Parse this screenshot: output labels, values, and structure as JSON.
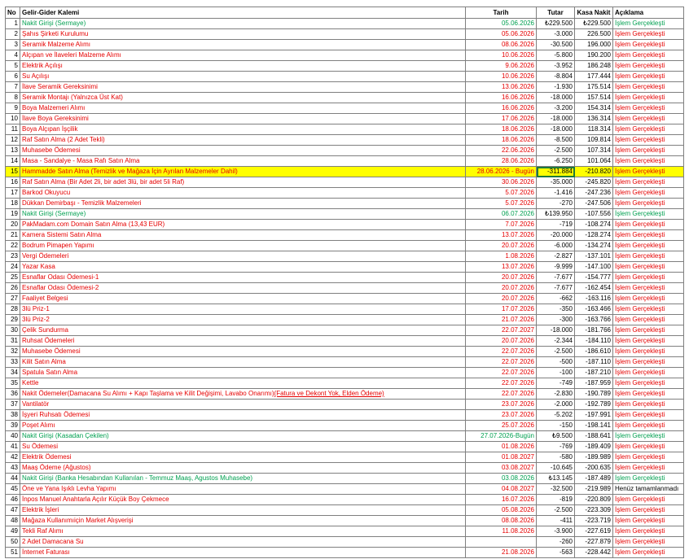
{
  "headers": {
    "no": "No",
    "item": "Gelir-Gider Kalemi",
    "date": "Tarih",
    "amount": "Tutar",
    "cash": "Kasa Nakit",
    "note": "Açıklama"
  },
  "colors": {
    "expense": "#e60000",
    "income": "#00a050",
    "highlight": "#ffff00"
  },
  "rows": [
    {
      "no": "1",
      "item": "Nakit Girişi (Sermaye)",
      "date": "05.06.2026",
      "amount": "₺229.500",
      "cash": "₺229.500",
      "note": "İşlem Gerçekleşti",
      "type": "green"
    },
    {
      "no": "2",
      "item": "Şahıs Şirketi Kurulumu",
      "date": "05.06.2026",
      "amount": "-3.000",
      "cash": "226.500",
      "note": "İşlem Gerçekleşti",
      "type": "red"
    },
    {
      "no": "3",
      "item": "Seramik Malzeme Alımı",
      "date": "08.06.2026",
      "amount": "-30.500",
      "cash": "196.000",
      "note": "İşlem Gerçekleşti",
      "type": "red"
    },
    {
      "no": "4",
      "item": "Alçıpan ve İlaveleri Malzeme Alımı",
      "date": "10.06.2026",
      "amount": "-5.800",
      "cash": "190.200",
      "note": "İşlem Gerçekleşti",
      "type": "red"
    },
    {
      "no": "5",
      "item": "Elektrik Açılışı",
      "date": "9.06.2026",
      "amount": "-3.952",
      "cash": "186.248",
      "note": "İşlem Gerçekleşti",
      "type": "red"
    },
    {
      "no": "6",
      "item": "Su Açılışı",
      "date": "10.06.2026",
      "amount": "-8.804",
      "cash": "177.444",
      "note": "İşlem Gerçekleşti",
      "type": "red"
    },
    {
      "no": "7",
      "item": "İlave Seramik Gereksinimi",
      "date": "13.06.2026",
      "amount": "-1.930",
      "cash": "175.514",
      "note": "İşlem Gerçekleşti",
      "type": "red"
    },
    {
      "no": "8",
      "item": "Seramik Montajı (Yalnızca Üst Kat)",
      "date": "16.06.2026",
      "amount": "-18.000",
      "cash": "157.514",
      "note": "İşlem Gerçekleşti",
      "type": "red"
    },
    {
      "no": "9",
      "item": "Boya Malzemeri Alımı",
      "date": "16.06.2026",
      "amount": "-3.200",
      "cash": "154.314",
      "note": "İşlem Gerçekleşti",
      "type": "red"
    },
    {
      "no": "10",
      "item": "İlave Boya Gereksinimi",
      "date": "17.06.2026",
      "amount": "-18.000",
      "cash": "136.314",
      "note": "İşlem Gerçekleşti",
      "type": "red"
    },
    {
      "no": "11",
      "item": "Boya Alçıpan İşçilik",
      "date": "18.06.2026",
      "amount": "-18.000",
      "cash": "118.314",
      "note": "İşlem Gerçekleşti",
      "type": "red"
    },
    {
      "no": "12",
      "item": "Raf Satın Alma (2 Adet Tekli)",
      "date": "18.06.2026",
      "amount": "-8.500",
      "cash": "109.814",
      "note": "İşlem Gerçekleşti",
      "type": "red"
    },
    {
      "no": "13",
      "item": "Muhasebe Ödemesi",
      "date": "22.06.2026",
      "amount": "-2.500",
      "cash": "107.314",
      "note": "İşlem Gerçekleşti",
      "type": "red"
    },
    {
      "no": "14",
      "item": "Masa - Sandalye - Masa Rafı Satın Alma",
      "date": "28.06.2026",
      "amount": "-6.250",
      "cash": "101.064",
      "note": "İşlem Gerçekleşti",
      "type": "red"
    },
    {
      "no": "15",
      "item": "Hammadde Satın Alma (Temizlik ve Mağaza İçin Ayrılan Malzemeler Dahil)",
      "date": "28.06.2026 - Bugün",
      "amount": "-311.884",
      "cash": "-210.820",
      "note": "İşlem Gerçekleşti",
      "type": "red",
      "highlight": true
    },
    {
      "no": "16",
      "item": "Raf Satın Alma (Bir Adet 2li, bir adet 3lü, bir adet 5li Raf)",
      "date": "30.06.2026",
      "amount": "-35.000",
      "cash": "-245.820",
      "note": "İşlem Gerçekleşti",
      "type": "red"
    },
    {
      "no": "17",
      "item": "Barkod Okuyucu",
      "date": "5.07.2026",
      "amount": "-1.416",
      "cash": "-247.236",
      "note": "İşlem Gerçekleşti",
      "type": "red"
    },
    {
      "no": "18",
      "item": "Dükkan Demirbaşı - Temizlik Malzemeleri",
      "date": "5.07.2026",
      "amount": "-270",
      "cash": "-247.506",
      "note": "İşlem Gerçekleşti",
      "type": "red"
    },
    {
      "no": "19",
      "item": "Nakit Girişi (Sermaye)",
      "date": "06.07.2026",
      "amount": "₺139.950",
      "cash": "-107.556",
      "note": "İşlem Gerçekleşti",
      "type": "green"
    },
    {
      "no": "20",
      "item": "PakMadam.com Domain Satın Alma (13,43 EUR)",
      "date": "7.07.2026",
      "amount": "-719",
      "cash": "-108.274",
      "note": "İşlem Gerçekleşti",
      "type": "red"
    },
    {
      "no": "21",
      "item": "Kamera Sistemi Satın Alma",
      "date": "13.07.2026",
      "amount": "-20.000",
      "cash": "-128.274",
      "note": "İşlem Gerçekleşti",
      "type": "red"
    },
    {
      "no": "22",
      "item": "Bodrum Pimapen Yapımı",
      "date": "20.07.2026",
      "amount": "-6.000",
      "cash": "-134.274",
      "note": "İşlem Gerçekleşti",
      "type": "red"
    },
    {
      "no": "23",
      "item": "Vergi Ödemeleri",
      "date": "1.08.2026",
      "amount": "-2.827",
      "cash": "-137.101",
      "note": "İşlem Gerçekleşti",
      "type": "red"
    },
    {
      "no": "24",
      "item": "Yazar Kasa",
      "date": "13.07.2026",
      "amount": "-9.999",
      "cash": "-147.100",
      "note": "İşlem Gerçekleşti",
      "type": "red"
    },
    {
      "no": "25",
      "item": "Esnaflar Odası Ödemesi-1",
      "date": "20.07.2026",
      "amount": "-7.677",
      "cash": "-154.777",
      "note": "İşlem Gerçekleşti",
      "type": "red"
    },
    {
      "no": "26",
      "item": "Esnaflar Odası Ödemesi-2",
      "date": "20.07.2026",
      "amount": "-7.677",
      "cash": "-162.454",
      "note": "İşlem Gerçekleşti",
      "type": "red"
    },
    {
      "no": "27",
      "item": "Faaliyet Belgesi",
      "date": "20.07.2026",
      "amount": "-662",
      "cash": "-163.116",
      "note": "İşlem Gerçekleşti",
      "type": "red"
    },
    {
      "no": "28",
      "item": "3lü Priz-1",
      "date": "17.07.2026",
      "amount": "-350",
      "cash": "-163.466",
      "note": "İşlem Gerçekleşti",
      "type": "red"
    },
    {
      "no": "29",
      "item": "3lü Priz-2",
      "date": "21.07.2026",
      "amount": "-300",
      "cash": "-163.766",
      "note": "İşlem Gerçekleşti",
      "type": "red"
    },
    {
      "no": "30",
      "item": "Çelik Sundurma",
      "date": "22.07.2027",
      "amount": "-18.000",
      "cash": "-181.766",
      "note": "İşlem Gerçekleşti",
      "type": "red"
    },
    {
      "no": "31",
      "item": "Ruhsat Ödemeleri",
      "date": "20.07.2026",
      "amount": "-2.344",
      "cash": "-184.110",
      "note": "İşlem Gerçekleşti",
      "type": "red"
    },
    {
      "no": "32",
      "item": "Muhasebe Ödemesi",
      "date": "22.07.2026",
      "amount": "-2.500",
      "cash": "-186.610",
      "note": "İşlem Gerçekleşti",
      "type": "red"
    },
    {
      "no": "33",
      "item": "Kilit Satın Alma",
      "date": "22.07.2026",
      "amount": "-500",
      "cash": "-187.110",
      "note": "İşlem Gerçekleşti",
      "type": "red"
    },
    {
      "no": "34",
      "item": "Spatula Satın Alma",
      "date": "22.07.2026",
      "amount": "-100",
      "cash": "-187.210",
      "note": "İşlem Gerçekleşti",
      "type": "red"
    },
    {
      "no": "35",
      "item": "Kettle",
      "date": "22.07.2026",
      "amount": "-749",
      "cash": "-187.959",
      "note": "İşlem Gerçekleşti",
      "type": "red"
    },
    {
      "no": "36",
      "item": "Nakit Ödemeler(Damacana Su Alımı + Kapı Taşlama ve Kilit Değişimi, Lavabo Onarımı)",
      "item_extra": "(Fatura ve Dekont Yok, Elden Ödeme)",
      "date": "22.07.2026",
      "amount": "-2.830",
      "cash": "-190.789",
      "note": "İşlem Gerçekleşti",
      "type": "red"
    },
    {
      "no": "37",
      "item": "Vantilatör",
      "date": "23.07.2026",
      "amount": "-2.000",
      "cash": "-192.789",
      "note": "İşlem Gerçekleşti",
      "type": "red"
    },
    {
      "no": "38",
      "item": "İşyeri Ruhsatı Ödemesi",
      "date": "23.07.2026",
      "amount": "-5.202",
      "cash": "-197.991",
      "note": "İşlem Gerçekleşti",
      "type": "red"
    },
    {
      "no": "39",
      "item": "Poşet Alımı",
      "date": "25.07.2026",
      "amount": "-150",
      "cash": "-198.141",
      "note": "İşlem Gerçekleşti",
      "type": "red"
    },
    {
      "no": "40",
      "item": "Nakit Girişi (Kasadan Çekilen)",
      "date": "27.07.2026-Bugün",
      "amount": "₺9.500",
      "cash": "-188.641",
      "note": "İşlem Gerçekleşti",
      "type": "green"
    },
    {
      "no": "41",
      "item": "Su Ödemesi",
      "date": "01.08.2026",
      "amount": "-769",
      "cash": "-189.409",
      "note": "İşlem Gerçekleşti",
      "type": "red"
    },
    {
      "no": "42",
      "item": "Elektrik Ödemesi",
      "date": "01.08.2027",
      "amount": "-580",
      "cash": "-189.989",
      "note": "İşlem Gerçekleşti",
      "type": "red"
    },
    {
      "no": "43",
      "item": "Maaş Ödeme (Ağustos)",
      "date": "03.08.2027",
      "amount": "-10.645",
      "cash": "-200.635",
      "note": "İşlem Gerçekleşti",
      "type": "red"
    },
    {
      "no": "44",
      "item": "Nakit Girişi (Banka Hesabından Kullanılan - Temmuz Maaş, Agustos Muhasebe)",
      "date": "03.08.2026",
      "amount": "₺13.145",
      "cash": "-187.489",
      "note": "İşlem Gerçekleşti",
      "type": "green"
    },
    {
      "no": "45",
      "item": "Öne ve Yana Işıklı Levha Yapımı",
      "date": "04.08.2027",
      "amount": "-32.500",
      "cash": "-219.989",
      "note": "Henüz tamamlanmadı",
      "type": "red",
      "pending": true
    },
    {
      "no": "46",
      "item": "İnpos Manuel Anahtarla Açılır Küçük Boy Çekmece",
      "date": "16.07.2026",
      "amount": "-819",
      "cash": "-220.809",
      "note": "İşlem Gerçekleşti",
      "type": "red"
    },
    {
      "no": "47",
      "item": "Elektrik İşleri",
      "date": "05.08.2026",
      "amount": "-2.500",
      "cash": "-223.309",
      "note": "İşlem Gerçekleşti",
      "type": "red"
    },
    {
      "no": "48",
      "item": "Mağaza Kullanımıiçin Market Alışverişi",
      "date": "08.08.2026",
      "amount": "-411",
      "cash": "-223.719",
      "note": "İşlem Gerçekleşti",
      "type": "red"
    },
    {
      "no": "49",
      "item": "Tekli Raf Alımı",
      "date": "11.08.2026",
      "amount": "-3.900",
      "cash": "-227.619",
      "note": "İşlem Gerçekleşti",
      "type": "red"
    },
    {
      "no": "50",
      "item": "2 Adet Damacana Su",
      "date": "",
      "amount": "-260",
      "cash": "-227.879",
      "note": "İşlem Gerçekleşti",
      "type": "red"
    },
    {
      "no": "51",
      "item": "İnternet Faturası",
      "date": "21.08.2026",
      "amount": "-563",
      "cash": "-228.442",
      "note": "İşlem Gerçekleşti",
      "type": "red"
    }
  ]
}
